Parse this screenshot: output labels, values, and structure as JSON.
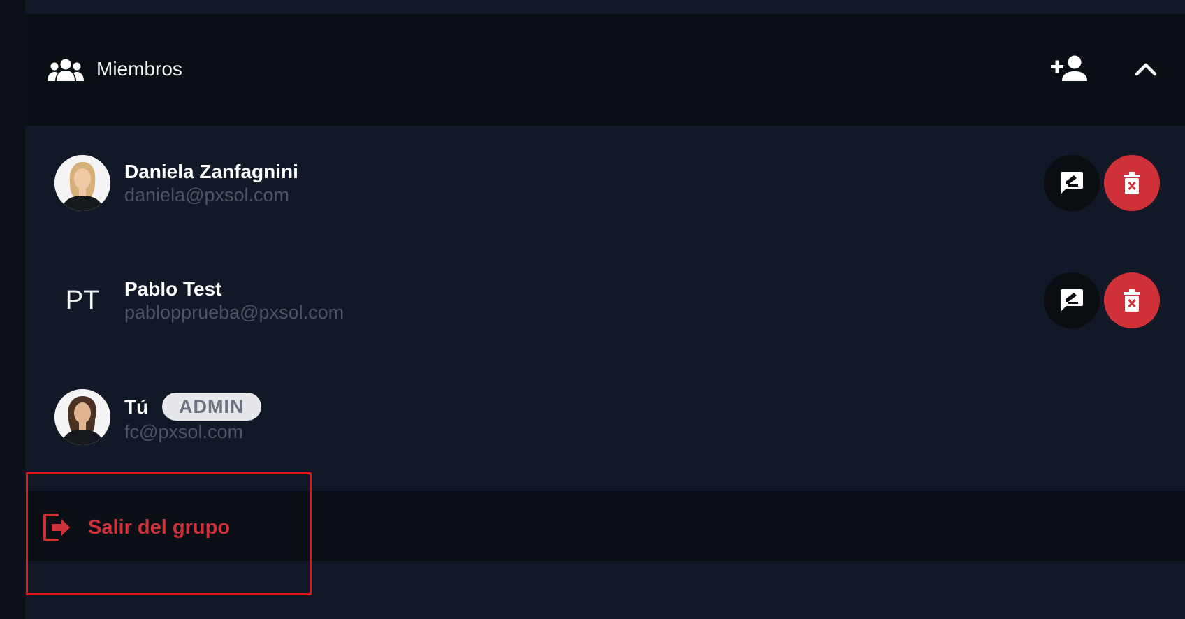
{
  "members_section": {
    "title": "Miembros",
    "icons": {
      "group": "group-icon",
      "add": "add-member-icon",
      "collapse": "chevron-up-icon"
    }
  },
  "members": [
    {
      "name": "Daniela Zanfagnini",
      "email": "daniela@pxsol.com",
      "avatar": "photo"
    },
    {
      "name": "Pablo Test",
      "email": "pablopprueba@pxsol.com",
      "initials": "PT"
    },
    {
      "name": "Tú",
      "email": "fc@pxsol.com",
      "role": "ADMIN",
      "avatar": "photo"
    }
  ],
  "actions": {
    "message_icon": "message-edit-icon",
    "delete_icon": "trash-icon"
  },
  "leave": {
    "label": "Salir del grupo",
    "icon": "logout-icon"
  },
  "colors": {
    "danger": "#d03138",
    "background": "#111827",
    "header_bg": "#0a0e15",
    "highlight": "#e11616"
  }
}
